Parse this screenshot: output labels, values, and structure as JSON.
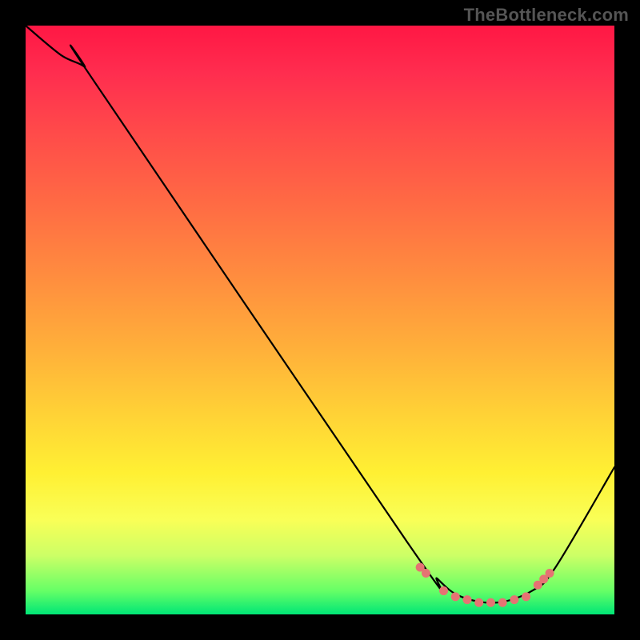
{
  "watermark": "TheBottleneck.com",
  "colors": {
    "background": "#000000",
    "gradient_top": "#ff1744",
    "gradient_mid": "#ffd236",
    "gradient_bottom": "#00e676",
    "curve_stroke": "#000000",
    "marker_fill": "#e57373"
  },
  "chart_data": {
    "type": "line",
    "title": "",
    "xlabel": "",
    "ylabel": "",
    "xlim": [
      0,
      100
    ],
    "ylim": [
      0,
      100
    ],
    "grid": false,
    "curve_points": [
      {
        "x": 0,
        "y": 100
      },
      {
        "x": 6,
        "y": 95
      },
      {
        "x": 10,
        "y": 93
      },
      {
        "x": 12,
        "y": 90
      },
      {
        "x": 65,
        "y": 12
      },
      {
        "x": 70,
        "y": 6
      },
      {
        "x": 74,
        "y": 3
      },
      {
        "x": 80,
        "y": 2
      },
      {
        "x": 86,
        "y": 4
      },
      {
        "x": 90,
        "y": 8
      },
      {
        "x": 100,
        "y": 25
      }
    ],
    "markers": [
      {
        "x": 67,
        "y": 8
      },
      {
        "x": 68,
        "y": 7
      },
      {
        "x": 71,
        "y": 4
      },
      {
        "x": 73,
        "y": 3
      },
      {
        "x": 75,
        "y": 2.5
      },
      {
        "x": 77,
        "y": 2
      },
      {
        "x": 79,
        "y": 2
      },
      {
        "x": 81,
        "y": 2
      },
      {
        "x": 83,
        "y": 2.5
      },
      {
        "x": 85,
        "y": 3
      },
      {
        "x": 87,
        "y": 5
      },
      {
        "x": 88,
        "y": 6
      },
      {
        "x": 89,
        "y": 7
      }
    ]
  }
}
